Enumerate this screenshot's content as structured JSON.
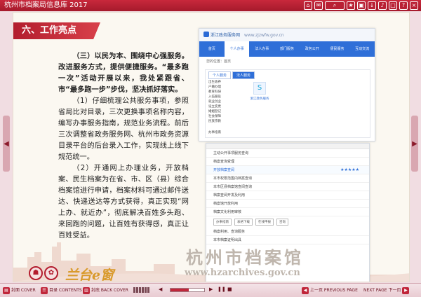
{
  "topbar": {
    "title": "杭州市档案局信息库 2017",
    "icons": [
      "home-icon",
      "mail-icon",
      "search-icon",
      "bookmark-icon",
      "print-icon",
      "download-icon",
      "sound-icon",
      "fullscreen-icon",
      "help-icon",
      "close-icon"
    ]
  },
  "page": {
    "heading": "六、工作亮点",
    "paragraphs": [
      "（三）以民为本、围绕中心强服务。改进服务方式，提供便捷服务。“最多跑一次”活动开展以来，我处紧跟省、市“最多跑一步”步伐，坚决抓好落实。",
      "（1）仔细梳理公共服务事项，参照省局比对目录，三次更换事项名称内容，编写办事服务指南，规范业务流程。前后三次调整省政务服务网、杭州市政务资源目录平台的后台录入工作，实现线上线下规范统一。",
      "（2）开通网上办理业务，开放档案、民生档案为在省、市、区（县）综合档案馆进行申请，档案材料可通过邮件送达、快递送达等方式获得，真正实现“网上办、就近办”，彻底解决百姓多头跑、来回跑的问题，让百姓有获得感，真正让百姓受益。"
    ],
    "shot1": {
      "site_title": "浙江政务服务网",
      "site_sub": "www.zjzwfw.gov.cn",
      "nav": [
        "首页",
        "个人办事",
        "法人办事",
        "部门服务",
        "政务公开",
        "便民服务",
        "互动交流"
      ],
      "crumb": "您的位置：首页",
      "tabs": [
        "个人服务",
        "法人服务"
      ],
      "list": [
        "出生收养",
        "户籍办理",
        "教育科研",
        "入伍服役",
        "就业创业",
        "设立变更",
        "婚姻登记",
        "社会保障",
        "民族宗教"
      ],
      "app_label": "浙江政务服务",
      "footer": "办事指南"
    },
    "shot2": {
      "rows": [
        "主动公开事项服务查询",
        "档案查询受理",
        "开放档案查阅",
        "本市权限范围内档案查询",
        "本市区县档案馆查阅查询",
        "档案查阅开发及利用",
        "档案馆开放利用",
        "档案文化利用审核",
        "档案利用、查询服务",
        "本市档案证明出具"
      ],
      "stars": "★★★★★",
      "buttons": [
        "办事指南",
        "表格下载",
        "在线申报",
        "咨询"
      ]
    },
    "brand": "兰台e窗",
    "watermark_name": "杭州市档案馆",
    "watermark_url": "www.hzarchives.gov.cn"
  },
  "bottombar": {
    "cover": "封面 COVER",
    "contents": "目录 CONTENTS",
    "back_cover": "封底 BACK COVER",
    "prev_page": "上一页 PREVIOUS PAGE",
    "next_page": "NEXT PAGE 下一页",
    "page_progress": 0.55
  }
}
